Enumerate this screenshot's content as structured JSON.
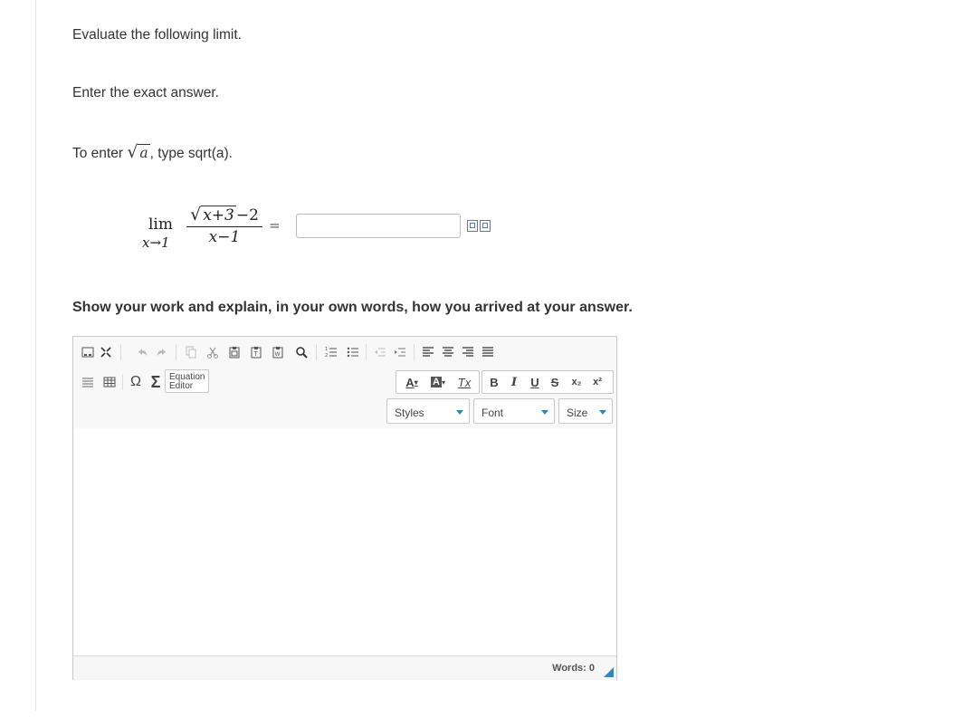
{
  "question": {
    "line1": "Evaluate the following limit.",
    "line2": "Enter the exact answer.",
    "line3_pre": "To enter ",
    "line3_var": "a",
    "line3_post": ", type sqrt(a).",
    "limit": {
      "lim": "lim",
      "sub": "x→1",
      "numerator_rad": "x+3",
      "numerator_rest": "−2",
      "denominator": "x−1",
      "equals": "="
    },
    "answer_value": "",
    "work_prompt": "Show your work and explain, in your own words, how you arrived at your answer."
  },
  "editor": {
    "equation_editor_label_1": "Equation",
    "equation_editor_label_2": "Editor",
    "omega": "Ω",
    "sigma": "Σ",
    "format": {
      "bold": "B",
      "italic": "I",
      "underline": "U",
      "strike": "S",
      "subscript": "x₂",
      "superscript": "x²",
      "font_color": "A",
      "bg_color": "A",
      "remove_format": "Tx"
    },
    "styles_label": "Styles",
    "font_label": "Font",
    "size_label": "Size",
    "body_text": "",
    "words_label": "Words: 0"
  },
  "colors": {
    "text": "#333333",
    "accent": "#2b88c5",
    "border": "#c8c8c8",
    "toolbar_bg": "#f8f8f8"
  }
}
